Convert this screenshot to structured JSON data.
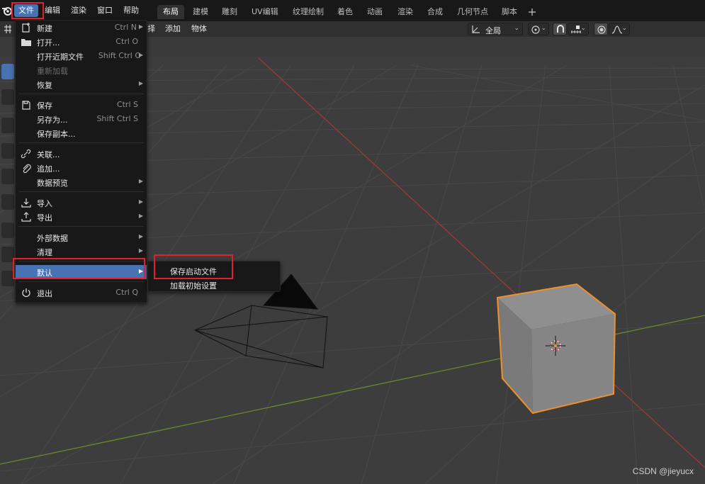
{
  "app": {
    "logo": "blender-logo"
  },
  "menubar": {
    "items": [
      "文件",
      "编辑",
      "渲染",
      "窗口",
      "帮助"
    ],
    "active": "文件"
  },
  "workspace_tabs": {
    "items": [
      "布局",
      "建模",
      "雕刻",
      "UV编辑",
      "纹理绘制",
      "着色",
      "动画",
      "渲染",
      "合成",
      "几何节点",
      "脚本"
    ],
    "active": "布局",
    "add_icon": "plus-icon"
  },
  "viewport_header": {
    "menus": [
      "择",
      "添加",
      "物体"
    ],
    "transform_orientation": "全局",
    "icons": [
      "transform-orientation-icon",
      "pivot-icon",
      "snap-icon",
      "snap-increment-icon",
      "proportional-edit-icon",
      "falloff-icon"
    ]
  },
  "file_menu": {
    "items": [
      {
        "label": "新建",
        "shortcut": "Ctrl N",
        "submenu": true,
        "icon": "new-file-icon"
      },
      {
        "label": "打开...",
        "shortcut": "Ctrl O",
        "icon": "folder-icon"
      },
      {
        "label": "打开近期文件",
        "shortcut": "Shift Ctrl O",
        "submenu": true
      },
      {
        "label": "重新加载",
        "disabled": true
      },
      {
        "label": "恢复",
        "submenu": true
      },
      {
        "label": "保存",
        "shortcut": "Ctrl S",
        "icon": "save-icon"
      },
      {
        "label": "另存为...",
        "shortcut": "Shift Ctrl S"
      },
      {
        "label": "保存副本..."
      },
      {
        "label": "关联...",
        "icon": "link-icon"
      },
      {
        "label": "追加...",
        "icon": "append-icon"
      },
      {
        "label": "数据预览",
        "submenu": true
      },
      {
        "label": "导入",
        "submenu": true,
        "icon": "import-icon"
      },
      {
        "label": "导出",
        "submenu": true,
        "icon": "export-icon"
      },
      {
        "label": "外部数据",
        "submenu": true
      },
      {
        "label": "清理",
        "submenu": true
      },
      {
        "label": "默认",
        "submenu": true,
        "highlighted": true
      },
      {
        "label": "退出",
        "shortcut": "Ctrl Q",
        "icon": "power-icon"
      }
    ]
  },
  "defaults_submenu": {
    "items": [
      "保存启动文件",
      "加载初始设置"
    ]
  },
  "colors": {
    "accent": "#4772b3",
    "annotation": "#e0202a",
    "selection_outline": "#f0902a",
    "x_axis": "#a03838",
    "y_axis": "#6a8a2a"
  },
  "watermark": "CSDN @jieyucx"
}
